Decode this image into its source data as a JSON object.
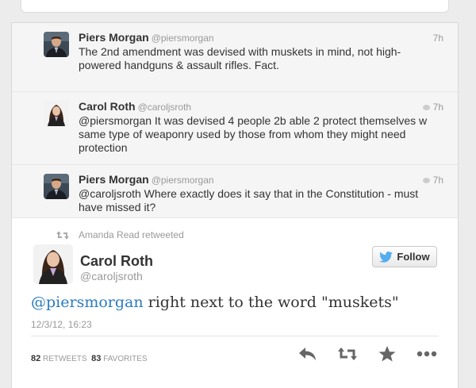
{
  "conversation": [
    {
      "name": "Piers Morgan",
      "handle": "@piersmorgan",
      "time": "7h",
      "text": "The 2nd amendment was devised with muskets in mind, not high-powered handguns & assault rifles. Fact.",
      "avatar_icon": "man-suit-avatar"
    },
    {
      "name": "Carol Roth",
      "handle": "@caroljsroth",
      "time": "7h",
      "text": "@piersmorgan It was devised 4 people 2b able 2 protect themselves w same type of weaponry used by those from whom they might need protection",
      "avatar_icon": "woman-avatar"
    },
    {
      "name": "Piers Morgan",
      "handle": "@piersmorgan",
      "time": "7h",
      "text": "@caroljsroth Where exactly does it say that in the Constitution - must have missed it?",
      "avatar_icon": "man-suit-avatar"
    }
  ],
  "main_tweet": {
    "retweeted_by": "Amanda Read retweeted",
    "name": "Carol Roth",
    "handle": "@caroljsroth",
    "follow_label": "Follow",
    "mention": "@piersmorgan",
    "text_rest": " right next to the word \"muskets\"",
    "date": "12/3/12, 16:23",
    "retweets_count": "82",
    "retweets_label": "RETWEETS",
    "favorites_count": "83",
    "favorites_label": "FAVORITES"
  },
  "colors": {
    "link": "#2a7bbf",
    "twitter_bird": "#55acee",
    "muted": "#999999"
  }
}
